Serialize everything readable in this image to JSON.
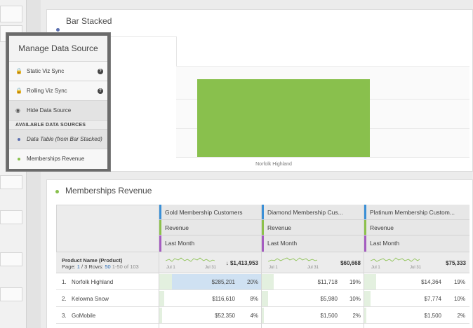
{
  "bar_panel": {
    "title": "Bar Stacked",
    "dot_color": "#5b6fb0"
  },
  "chart_data": {
    "type": "bar",
    "categories": [
      "Norfolk Highland"
    ],
    "series": [
      {
        "values": [
          285201
        ],
        "color": "#89c04d"
      }
    ],
    "ylim": [
      0,
      330000
    ],
    "grid": true,
    "legend": "none"
  },
  "popup": {
    "title": "Manage Data Source",
    "items": [
      {
        "label": "Static Viz Sync",
        "icon": "lock-icon",
        "help": "?"
      },
      {
        "label": "Rolling Viz Sync",
        "icon": "lock-icon",
        "help": "?"
      },
      {
        "label": "Hide Data Source",
        "icon": "eye-slash-icon"
      }
    ],
    "section_label": "AVAILABLE DATA SOURCES",
    "sources": [
      {
        "label": "Data Table (from Bar Stacked)",
        "color": "#5b6fb0"
      },
      {
        "label": "Memberships Revenue",
        "color": "#89c04d"
      }
    ]
  },
  "table_panel": {
    "title": "Memberships Revenue",
    "dot_color": "#89c04d"
  },
  "table": {
    "dimension": "Product Name (Product)",
    "pagination": {
      "prefix": "Page:",
      "page": "1",
      "of": "/ 3",
      "rows_label": "Rows:",
      "rows": "50",
      "range": "1-50 of 103"
    },
    "columns": [
      {
        "segment": "Gold Membership Customers",
        "metric": "Revenue",
        "date": "Last Month",
        "total": "$1,413,953",
        "trend_arrow": "↓",
        "jul1": "Jul 1",
        "jul31": "Jul 31"
      },
      {
        "segment": "Diamond Membership Cus...",
        "metric": "Revenue",
        "date": "Last Month",
        "total": "$60,668",
        "jul1": "Jul 1",
        "jul31": "Jul 31"
      },
      {
        "segment": "Platinum Membership Custom...",
        "metric": "Revenue",
        "date": "Last Month",
        "total": "$75,333",
        "jul1": "Jul 1",
        "jul31": "Jul 31"
      }
    ],
    "tag_colors": {
      "segment": "#3a8fd6",
      "metric": "#8cc04b",
      "date": "#a45cc0"
    },
    "rows": [
      {
        "num": "1.",
        "name": "Norfolk Highland",
        "cells": [
          {
            "value": "$285,201",
            "pct": "20%",
            "share": 0.2
          },
          {
            "value": "$11,718",
            "pct": "19%",
            "share": 0.19
          },
          {
            "value": "$14,364",
            "pct": "19%",
            "share": 0.19
          }
        ]
      },
      {
        "num": "2.",
        "name": "Kelowna Snow",
        "cells": [
          {
            "value": "$116,610",
            "pct": "8%",
            "share": 0.08
          },
          {
            "value": "$5,980",
            "pct": "10%",
            "share": 0.1
          },
          {
            "value": "$7,774",
            "pct": "10%",
            "share": 0.1
          }
        ]
      },
      {
        "num": "3.",
        "name": "GoMobile",
        "cells": [
          {
            "value": "$52,350",
            "pct": "4%",
            "share": 0.04
          },
          {
            "value": "$1,500",
            "pct": "2%",
            "share": 0.02
          },
          {
            "value": "$1,500",
            "pct": "2%",
            "share": 0.02
          }
        ]
      }
    ]
  }
}
